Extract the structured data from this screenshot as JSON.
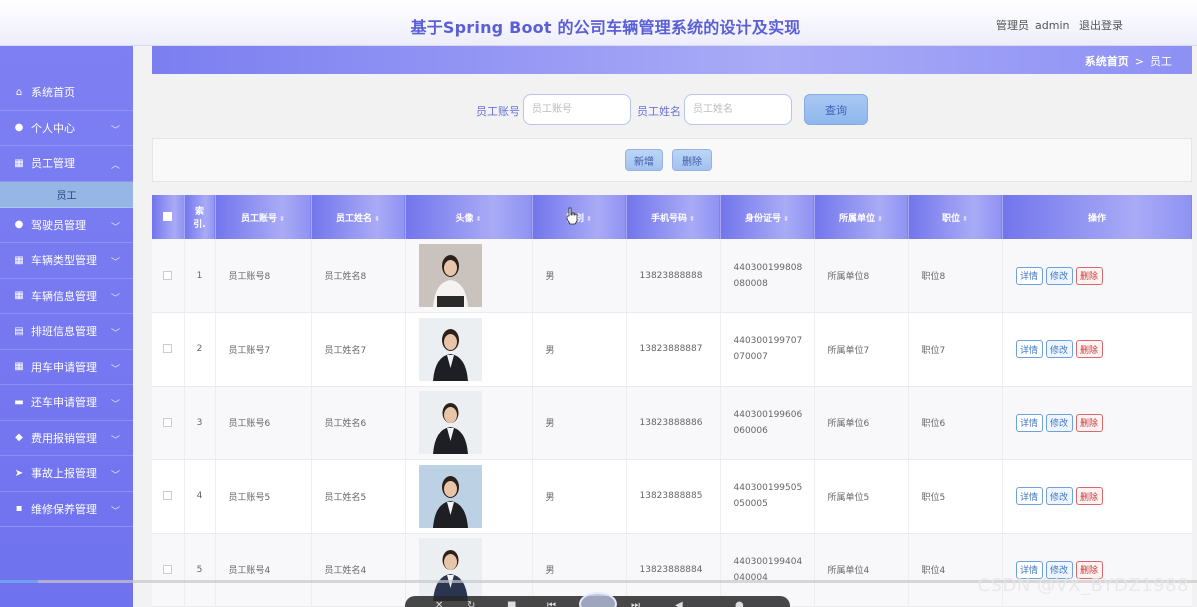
{
  "header": {
    "title": "基于Spring Boot 的公司车辆管理系统的设计及实现",
    "user_role": "管理员",
    "username": "admin",
    "logout_label": "退出登录"
  },
  "sidebar": {
    "items": [
      {
        "label": "系统首页",
        "icon": "home-icon"
      },
      {
        "label": "个人中心",
        "icon": "user-icon"
      },
      {
        "label": "员工管理",
        "icon": "grid-icon",
        "expanded": true
      },
      {
        "label": "驾驶员管理",
        "icon": "user-icon"
      },
      {
        "label": "车辆类型管理",
        "icon": "grid-icon"
      },
      {
        "label": "车辆信息管理",
        "icon": "grid-icon"
      },
      {
        "label": "排班信息管理",
        "icon": "chart-icon"
      },
      {
        "label": "用车申请管理",
        "icon": "grid-icon"
      },
      {
        "label": "还车申请管理",
        "icon": "briefcase-icon"
      },
      {
        "label": "费用报销管理",
        "icon": "map-pin-icon"
      },
      {
        "label": "事故上报管理",
        "icon": "send-icon"
      },
      {
        "label": "维修保养管理",
        "icon": "comment-icon"
      }
    ],
    "submenu_active": "员工"
  },
  "breadcrumb": {
    "home": "系统首页",
    "separator": ">",
    "current": "员工"
  },
  "search": {
    "account_label": "员工账号",
    "account_placeholder": "员工账号",
    "name_label": "员工姓名",
    "name_placeholder": "员工姓名",
    "query_label": "查询"
  },
  "actions": {
    "add_label": "新增",
    "delete_label": "删除"
  },
  "table": {
    "columns": [
      "索引",
      "员工账号",
      "员工姓名",
      "头像",
      "性别",
      "手机号码",
      "身份证号",
      "所属单位",
      "职位",
      "操作"
    ],
    "index_header_line1": "索",
    "index_header_line2": "引.",
    "gender_header_partial": "性别",
    "rows": [
      {
        "index": "1",
        "account": "员工账号8",
        "name": "员工姓名8",
        "gender": "男",
        "phone": "13823888888",
        "id_number": "440300199808080008",
        "unit": "所属单位8",
        "position": "职位8",
        "photo": "woman-white-blouse"
      },
      {
        "index": "2",
        "account": "员工账号7",
        "name": "员工姓名7",
        "gender": "男",
        "phone": "13823888887",
        "id_number": "440300199707070007",
        "unit": "所属单位7",
        "position": "职位7",
        "photo": "woman-black-suit"
      },
      {
        "index": "3",
        "account": "员工账号6",
        "name": "员工姓名6",
        "gender": "男",
        "phone": "13823888886",
        "id_number": "440300199606060006",
        "unit": "所属单位6",
        "position": "职位6",
        "photo": "man-dark-suit"
      },
      {
        "index": "4",
        "account": "员工账号5",
        "name": "员工姓名5",
        "gender": "男",
        "phone": "13823888885",
        "id_number": "440300199505050005",
        "unit": "所属单位5",
        "position": "职位5",
        "photo": "woman-office"
      },
      {
        "index": "5",
        "account": "员工账号4",
        "name": "员工姓名4",
        "gender": "男",
        "phone": "13823888884",
        "id_number": "440300199404040004",
        "unit": "所属单位4",
        "position": "职位4",
        "photo": "man-blue-suit"
      }
    ],
    "op_detail": "详情",
    "op_edit": "修改",
    "op_delete": "删除"
  },
  "colors": {
    "accent": "#6f72ee",
    "title": "#5b5fd6",
    "delete": "#c43c3c"
  },
  "overlay": {
    "watermark": "CSDN @VX_BYDZ1988"
  }
}
